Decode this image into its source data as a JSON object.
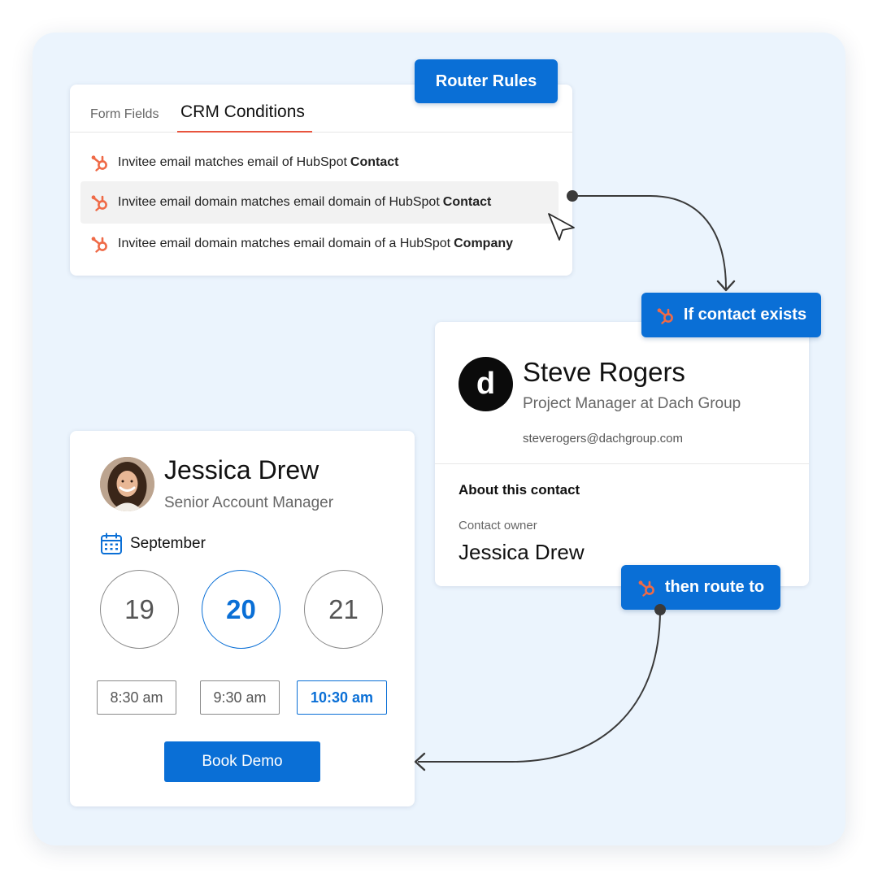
{
  "router_rules": {
    "label": "Router Rules"
  },
  "crm_card": {
    "tabs": [
      {
        "label": "Form Fields",
        "active": false
      },
      {
        "label": "CRM Conditions",
        "active": true
      }
    ],
    "rules": [
      {
        "text": "Invitee email matches email of HubSpot",
        "bold": "Contact",
        "highlighted": false
      },
      {
        "text": "Invitee email domain matches email domain of HubSpot",
        "bold": "Contact",
        "highlighted": true
      },
      {
        "text": "Invitee email domain matches email domain of a HubSpot",
        "bold": "Company",
        "highlighted": false
      }
    ]
  },
  "condition_pill": {
    "label": "If contact exists",
    "icon": "hubspot-icon"
  },
  "contact_card": {
    "avatar_letter": "d",
    "name": "Steve Rogers",
    "title": "Project Manager at Dach Group",
    "email": "steverogers@dachgroup.com",
    "section_heading": "About this contact",
    "owner_label": "Contact owner",
    "owner_name": "Jessica Drew"
  },
  "route_pill": {
    "label": "then route to",
    "icon": "hubspot-icon"
  },
  "booking_card": {
    "name": "Jessica Drew",
    "title": "Senior Account Manager",
    "month": "September",
    "days": [
      {
        "label": "19",
        "selected": false
      },
      {
        "label": "20",
        "selected": true
      },
      {
        "label": "21",
        "selected": false
      }
    ],
    "times": [
      {
        "label": "8:30 am",
        "selected": false
      },
      {
        "label": "9:30 am",
        "selected": false
      },
      {
        "label": "10:30 am",
        "selected": true
      }
    ],
    "cta": "Book Demo"
  },
  "colors": {
    "accent": "#0a6fd6",
    "hubspot": "#ef6a47",
    "background": "#ebf4fd",
    "tab_underline": "#e8543e"
  }
}
